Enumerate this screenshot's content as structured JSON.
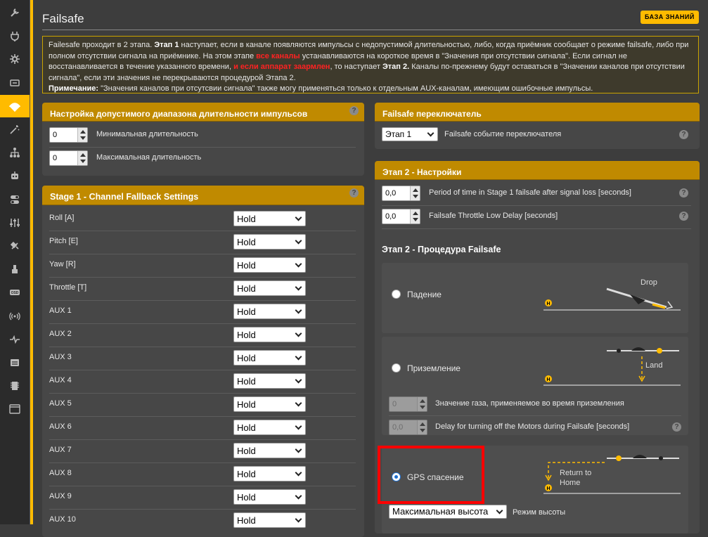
{
  "sidebar": {
    "items": [
      {
        "icon": "wrench-icon"
      },
      {
        "icon": "plug-icon"
      },
      {
        "icon": "gear-icon"
      },
      {
        "icon": "receiver-icon"
      },
      {
        "icon": "parachute-icon",
        "active": true
      },
      {
        "icon": "magic-wand-icon"
      },
      {
        "icon": "network-icon"
      },
      {
        "icon": "robot-icon"
      },
      {
        "icon": "toggles-icon"
      },
      {
        "icon": "sliders-icon"
      },
      {
        "icon": "satellite-icon"
      },
      {
        "icon": "motor-icon"
      },
      {
        "icon": "osd-icon"
      },
      {
        "icon": "antenna-icon"
      },
      {
        "icon": "pulse-icon"
      },
      {
        "icon": "blackbox-icon"
      },
      {
        "icon": "chip-icon"
      },
      {
        "icon": "terminal-icon"
      }
    ]
  },
  "page": {
    "title": "Failsafe",
    "wiki_button": "БАЗА ЗНАНИЙ"
  },
  "note": {
    "p1_a": "Failesafe проходит в 2 этапа. ",
    "p1_b": "Этап 1",
    "p1_c": " наступает, если в канале появляются импульсы с недопустимой длительностью, либо, когда приёмник сообщает о режиме failsafe, либо при полном отсутствии сигнала на приёмнике. На этом этапе ",
    "p1_d": "все каналы",
    "p1_e": " устанавливаются на короткое время в \"Значения при отсутствии сигнала\". Если сигнал не восстанавливается в течение указанного времени, ",
    "p1_f": "и если аппарат заармлен",
    "p1_g": ", то наступает ",
    "p1_h": "Этап 2.",
    "p1_i": " Каналы по-прежнему будут оставаться в \"Значении каналов при отсутствии сигнала\", если эти значения не перекрываются процедурой Этапа 2.",
    "p2_a": "Примечание:",
    "p2_b": " \"Значения каналов при отсутсвии сигнала\" также могу применяться только к отдельным AUX-каналам, имеющим ошибочные импульсы."
  },
  "pulse_panel": {
    "title": "Настройка допустимого диапазона длительности импульсов",
    "min_value": "0",
    "min_label": "Минимальная длительность",
    "max_value": "0",
    "max_label": "Максимальная длительность"
  },
  "stage1_panel": {
    "title": "Stage 1 - Channel Fallback Settings",
    "channels": [
      {
        "name": "Roll [A]",
        "mode": "Hold"
      },
      {
        "name": "Pitch [E]",
        "mode": "Hold"
      },
      {
        "name": "Yaw [R]",
        "mode": "Hold"
      },
      {
        "name": "Throttle [T]",
        "mode": "Hold"
      },
      {
        "name": "AUX 1",
        "mode": "Hold"
      },
      {
        "name": "AUX 2",
        "mode": "Hold"
      },
      {
        "name": "AUX 3",
        "mode": "Hold"
      },
      {
        "name": "AUX 4",
        "mode": "Hold"
      },
      {
        "name": "AUX 5",
        "mode": "Hold"
      },
      {
        "name": "AUX 6",
        "mode": "Hold"
      },
      {
        "name": "AUX 7",
        "mode": "Hold"
      },
      {
        "name": "AUX 8",
        "mode": "Hold"
      },
      {
        "name": "AUX 9",
        "mode": "Hold"
      },
      {
        "name": "AUX 10",
        "mode": "Hold"
      }
    ]
  },
  "switch_panel": {
    "title": "Failsafe переключатель",
    "select_value": "Этап 1",
    "label": "Failsafe событие переключателя"
  },
  "stage2_panel": {
    "title": "Этап 2 - Настройки",
    "guard_value": "0,0",
    "guard_label": "Period of time in Stage 1 failsafe after signal loss [seconds]",
    "delay_value": "0,0",
    "delay_label": "Failsafe Throttle Low Delay [seconds]",
    "procedure_title": "Этап 2 - Процедура Failsafe",
    "drop_label": "Падение",
    "drop_caption": "Drop",
    "land_label": "Приземление",
    "land_caption": "Land",
    "land_throttle_value": "0",
    "land_throttle_label": "Значение газа, применяемое во время приземления",
    "land_motor_value": "0,0",
    "land_motor_label": "Delay for turning off the Motors during Failsafe [seconds]",
    "gps_label": "GPS спасение",
    "gps_caption_1": "Return to",
    "gps_caption_2": "Home",
    "altitude_mode_value": "Максимальная высота",
    "altitude_mode_label": "Режим высоты",
    "home_marker": "H"
  },
  "colors": {
    "accent": "#ffbb00",
    "highlight": "#ff0000"
  }
}
